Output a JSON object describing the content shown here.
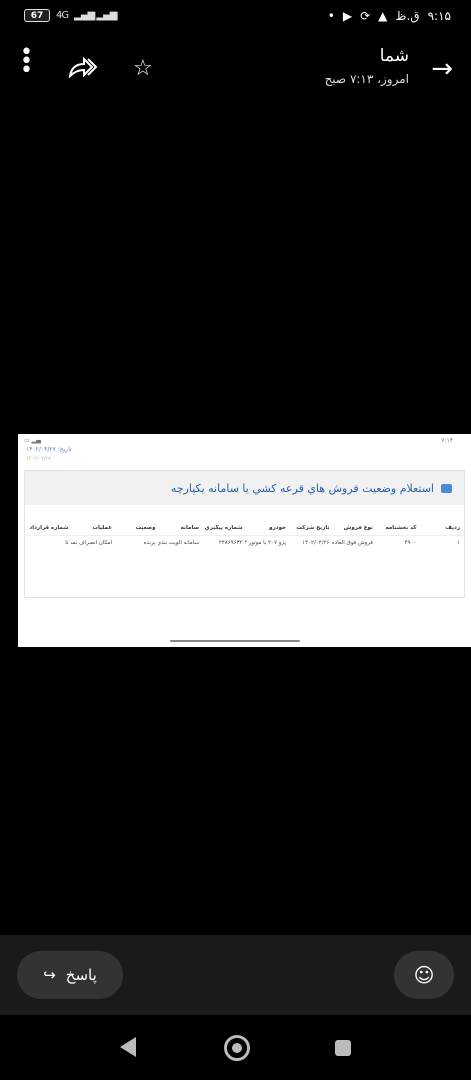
{
  "status_bar": {
    "time": "۹:۱۵",
    "carrier_indicators": "ق.ظ",
    "battery": "67",
    "network": "4G"
  },
  "header": {
    "sender": "شما",
    "time": "امروز، ۷:۱۳ صبح"
  },
  "screenshot": {
    "mini_time": "۷:۱۴",
    "date_label": "تاریخ: ۱۴۰۲/۰۴/۲۷",
    "date_sub": "۱۴۰۲/۰۴/۲۷",
    "card_title": "استعلام وضعيت فروش هاي قرعه کشي يا سامانه يکپارچه",
    "columns": [
      "رديف",
      "کد بخشنامه",
      "نوع فروش",
      "تاريخ شرکت",
      "خودرو",
      "شماره پيگيري",
      "سامانه",
      "وضعيت",
      "عمليات",
      "شماره قرارداد آخرين"
    ],
    "row": [
      "۱",
      "۴۹۰۰",
      "فروش فوق العاده",
      "۱۴۰۲/۰۴/۲۶",
      "پژو ۲۰۷ با موتور TU۳",
      "۲۴۸۶۹۶۳۲",
      "سامانه الويت بندي",
      "برنده",
      "امکان انصراف نمي باشد",
      "تا"
    ]
  },
  "bottom_bar": {
    "reply_label": "پاسخ"
  },
  "icons": [
    "more-icon",
    "forward-all-icon",
    "star-icon",
    "back-arrow-icon",
    "reply-icon",
    "emoji-icon"
  ]
}
